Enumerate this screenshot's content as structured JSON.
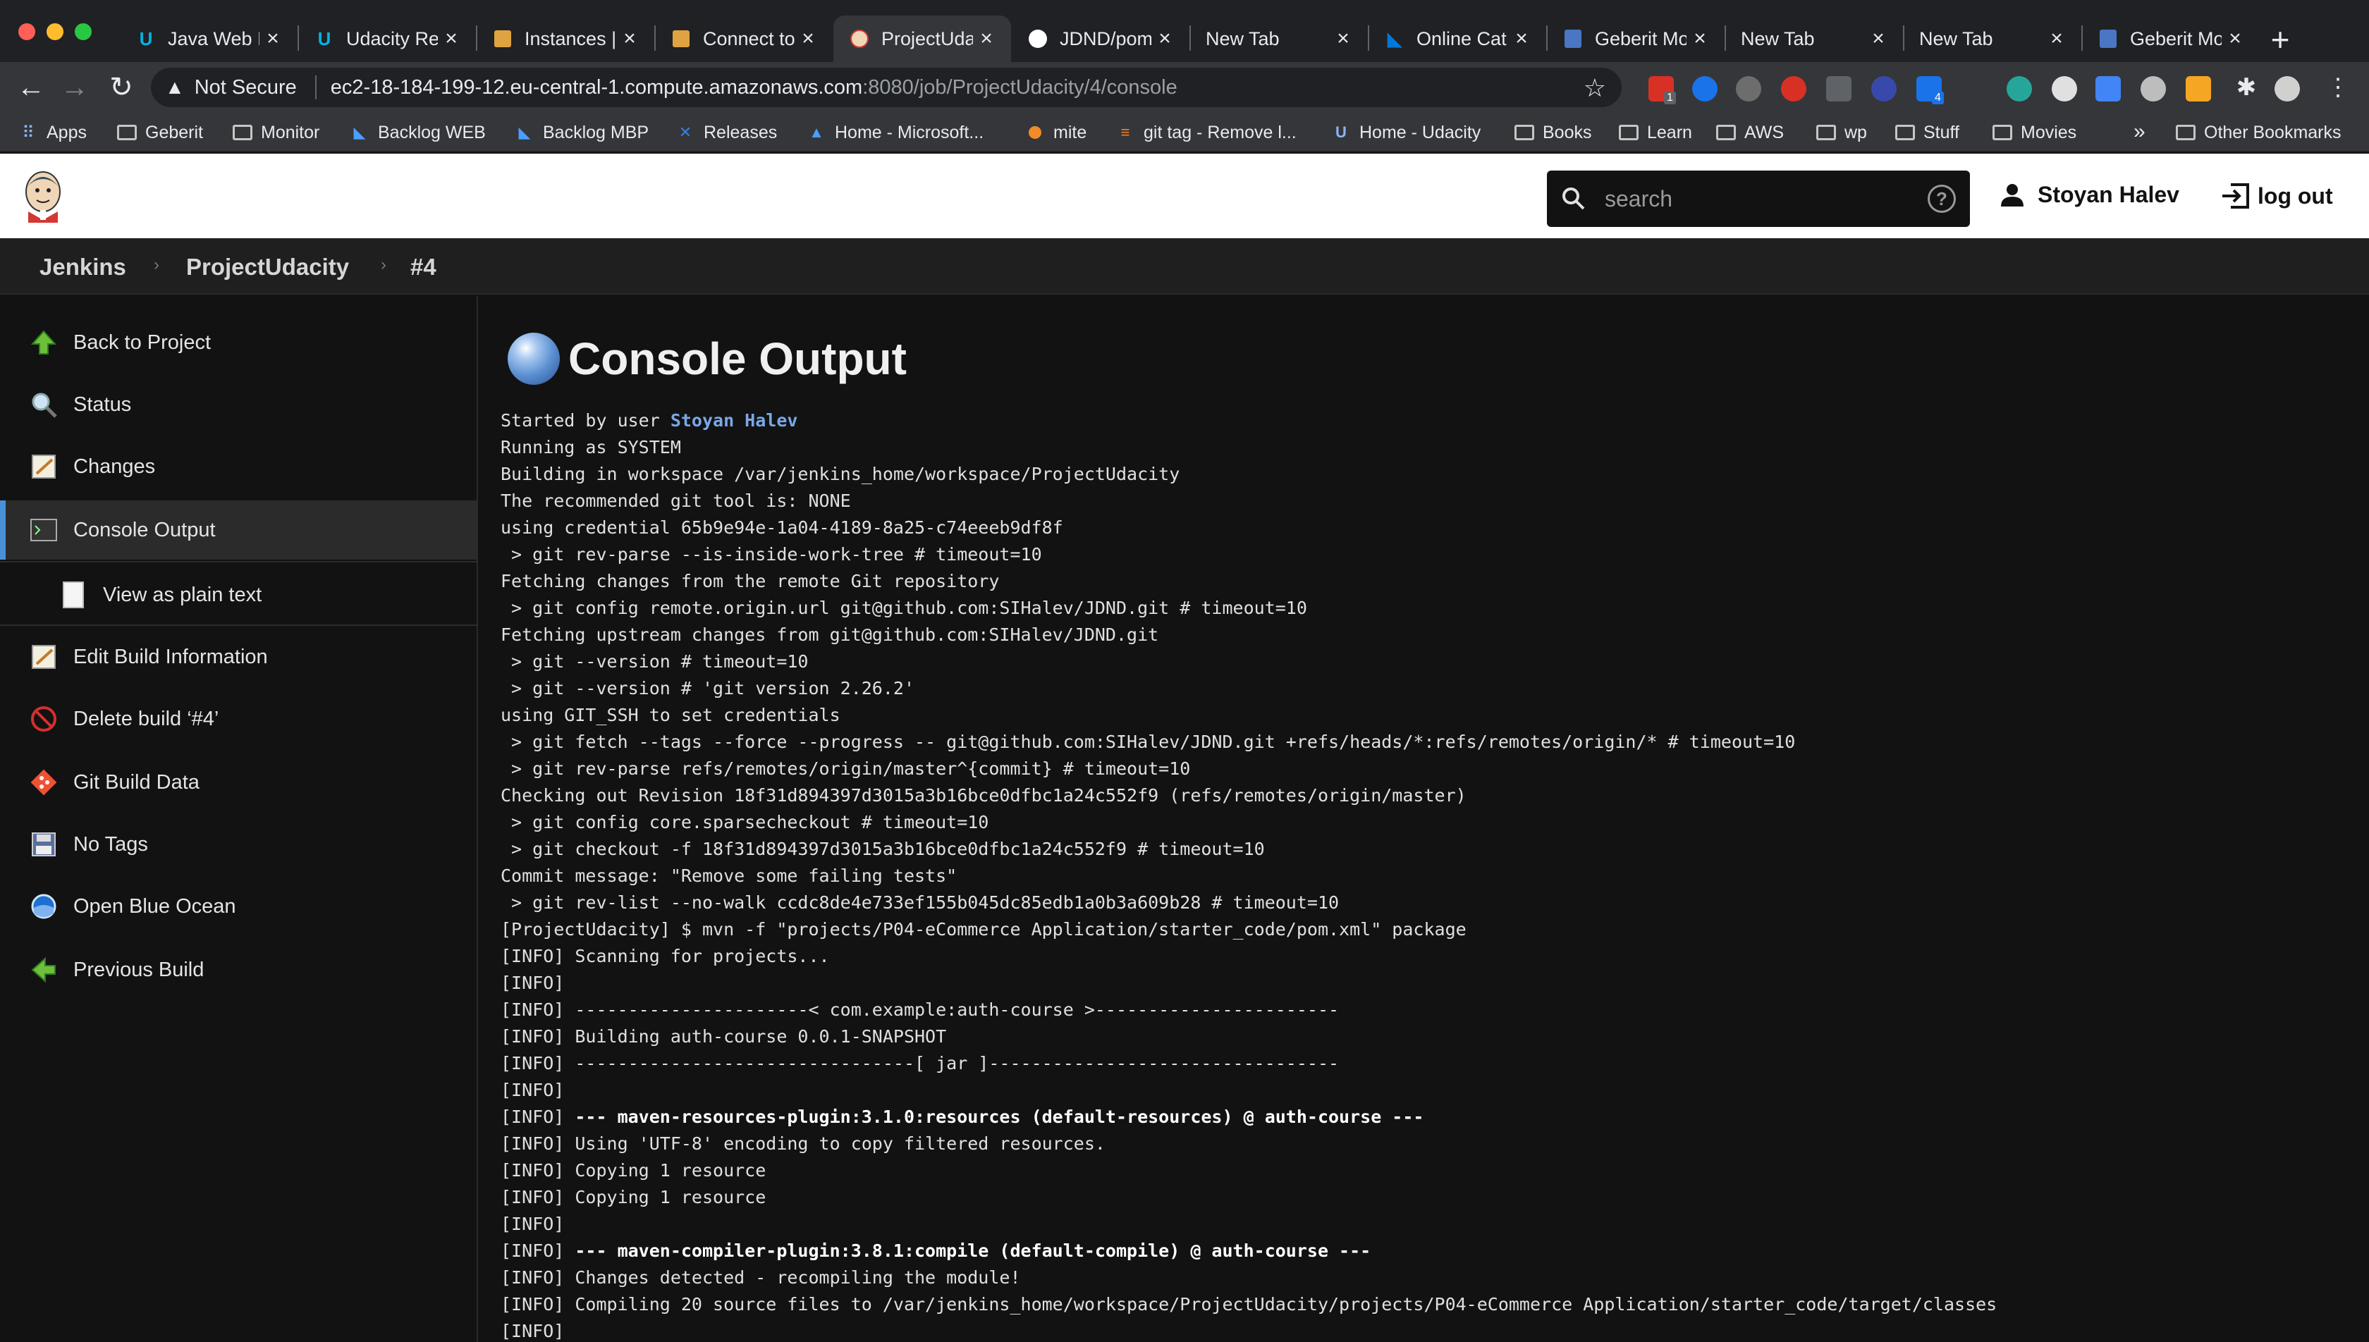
{
  "browser": {
    "tabs": [
      {
        "label": "Java Web D",
        "icon": "udacity-icon"
      },
      {
        "label": "Udacity Re",
        "icon": "udacity-icon"
      },
      {
        "label": "Instances |",
        "icon": "aws-cube-icon"
      },
      {
        "label": "Connect to",
        "icon": "aws-cube-icon"
      },
      {
        "label": "ProjectUda",
        "icon": "jenkins-icon",
        "active": true
      },
      {
        "label": "JDND/pom",
        "icon": "github-icon"
      },
      {
        "label": "New Tab",
        "icon": ""
      },
      {
        "label": "Online Cat",
        "icon": "azure-devops-icon"
      },
      {
        "label": "Geberit Mo",
        "icon": "doc-icon"
      },
      {
        "label": "New Tab",
        "icon": ""
      },
      {
        "label": "New Tab",
        "icon": ""
      },
      {
        "label": "Geberit Mo",
        "icon": "doc-icon"
      }
    ],
    "close_glyph": "×",
    "new_tab_glyph": "+",
    "address": {
      "security_label": "Not Secure",
      "host": "ec2-18-184-199-12.eu-central-1.compute.amazonaws.com",
      "path": ":8080/job/ProjectUdacity/4/console"
    },
    "extension_badges": [
      "1",
      "4"
    ],
    "bookmarks": [
      {
        "label": "Apps",
        "icon": "apps-grid-icon"
      },
      {
        "label": "Geberit",
        "icon": "folder-icon"
      },
      {
        "label": "Monitor",
        "icon": "folder-icon"
      },
      {
        "label": "Backlog WEB",
        "icon": "azure-devops-icon"
      },
      {
        "label": "Backlog MBP",
        "icon": "azure-devops-icon"
      },
      {
        "label": "Releases",
        "icon": "releases-icon"
      },
      {
        "label": "Home - Microsoft...",
        "icon": "azure-icon"
      },
      {
        "label": "mite",
        "icon": "mite-icon"
      },
      {
        "label": "git tag - Remove l...",
        "icon": "stackoverflow-icon"
      },
      {
        "label": "Home - Udacity",
        "icon": "udacity-icon"
      },
      {
        "label": "Books",
        "icon": "folder-icon"
      },
      {
        "label": "Learn",
        "icon": "folder-icon"
      },
      {
        "label": "AWS",
        "icon": "folder-icon"
      },
      {
        "label": "wp",
        "icon": "folder-icon"
      },
      {
        "label": "Stuff",
        "icon": "folder-icon"
      },
      {
        "label": "Movies",
        "icon": "folder-icon"
      }
    ],
    "bookmarks_more": "»",
    "other_bookmarks": "Other Bookmarks"
  },
  "jenkins": {
    "search_placeholder": "search",
    "help_glyph": "?",
    "user_name": "Stoyan Halev",
    "logout_label": "log out",
    "breadcrumbs": [
      "Jenkins",
      "ProjectUdacity",
      "#4"
    ],
    "sidebar": [
      {
        "label": "Back to Project",
        "icon": "up-arrow-icon"
      },
      {
        "label": "Status",
        "icon": "magnifier-icon"
      },
      {
        "label": "Changes",
        "icon": "notepad-icon"
      },
      {
        "label": "Console Output",
        "icon": "terminal-icon",
        "active": true
      },
      {
        "label": "View as plain text",
        "icon": "document-icon",
        "sub": true
      },
      {
        "label": "Edit Build Information",
        "icon": "notepad-icon"
      },
      {
        "label": "Delete build ‘#4’",
        "icon": "no-entry-icon"
      },
      {
        "label": "Git Build Data",
        "icon": "git-icon"
      },
      {
        "label": "No Tags",
        "icon": "floppy-disk-icon"
      },
      {
        "label": "Open Blue Ocean",
        "icon": "blue-ocean-icon"
      },
      {
        "label": "Previous Build",
        "icon": "left-arrow-icon"
      }
    ],
    "page_title": "Console Output",
    "console": {
      "started_prefix": "Started by user ",
      "started_user": "Stoyan Halev",
      "lines": [
        "Running as SYSTEM",
        "Building in workspace /var/jenkins_home/workspace/ProjectUdacity",
        "The recommended git tool is: NONE",
        "using credential 65b9e94e-1a04-4189-8a25-c74eeeb9df8f",
        " > git rev-parse --is-inside-work-tree # timeout=10",
        "Fetching changes from the remote Git repository",
        " > git config remote.origin.url git@github.com:SIHalev/JDND.git # timeout=10",
        "Fetching upstream changes from git@github.com:SIHalev/JDND.git",
        " > git --version # timeout=10",
        " > git --version # 'git version 2.26.2'",
        "using GIT_SSH to set credentials",
        " > git fetch --tags --force --progress -- git@github.com:SIHalev/JDND.git +refs/heads/*:refs/remotes/origin/* # timeout=10",
        " > git rev-parse refs/remotes/origin/master^{commit} # timeout=10",
        "Checking out Revision 18f31d894397d3015a3b16bce0dfbc1a24c552f9 (refs/remotes/origin/master)",
        " > git config core.sparsecheckout # timeout=10",
        " > git checkout -f 18f31d894397d3015a3b16bce0dfbc1a24c552f9 # timeout=10",
        "Commit message: \"Remove some failing tests\"",
        " > git rev-list --no-walk ccdc8de4e733ef155b045dc85edb1a0b3a609b28 # timeout=10",
        "[ProjectUdacity] $ mvn -f \"projects/P04-eCommerce Application/starter_code/pom.xml\" package",
        "[INFO] Scanning for projects...",
        "[INFO]",
        "[INFO] ----------------------< com.example:auth-course >-----------------------",
        "[INFO] Building auth-course 0.0.1-SNAPSHOT",
        "[INFO] --------------------------------[ jar ]---------------------------------",
        "[INFO]",
        {
          "prefix": "[INFO] ",
          "bold": "--- maven-resources-plugin:3.1.0:resources (default-resources) @ auth-course ---"
        },
        "[INFO] Using 'UTF-8' encoding to copy filtered resources.",
        "[INFO] Copying 1 resource",
        "[INFO] Copying 1 resource",
        "[INFO]",
        {
          "prefix": "[INFO] ",
          "bold": "--- maven-compiler-plugin:3.8.1:compile (default-compile) @ auth-course ---"
        },
        "[INFO] Changes detected - recompiling the module!",
        "[INFO] Compiling 20 source files to /var/jenkins_home/workspace/ProjectUdacity/projects/P04-eCommerce Application/starter_code/target/classes",
        "[INFO]"
      ]
    }
  },
  "colors": {
    "accent_link": "#7aa7e6",
    "active_marker": "#4a90d9",
    "console_bg": "#121212"
  }
}
